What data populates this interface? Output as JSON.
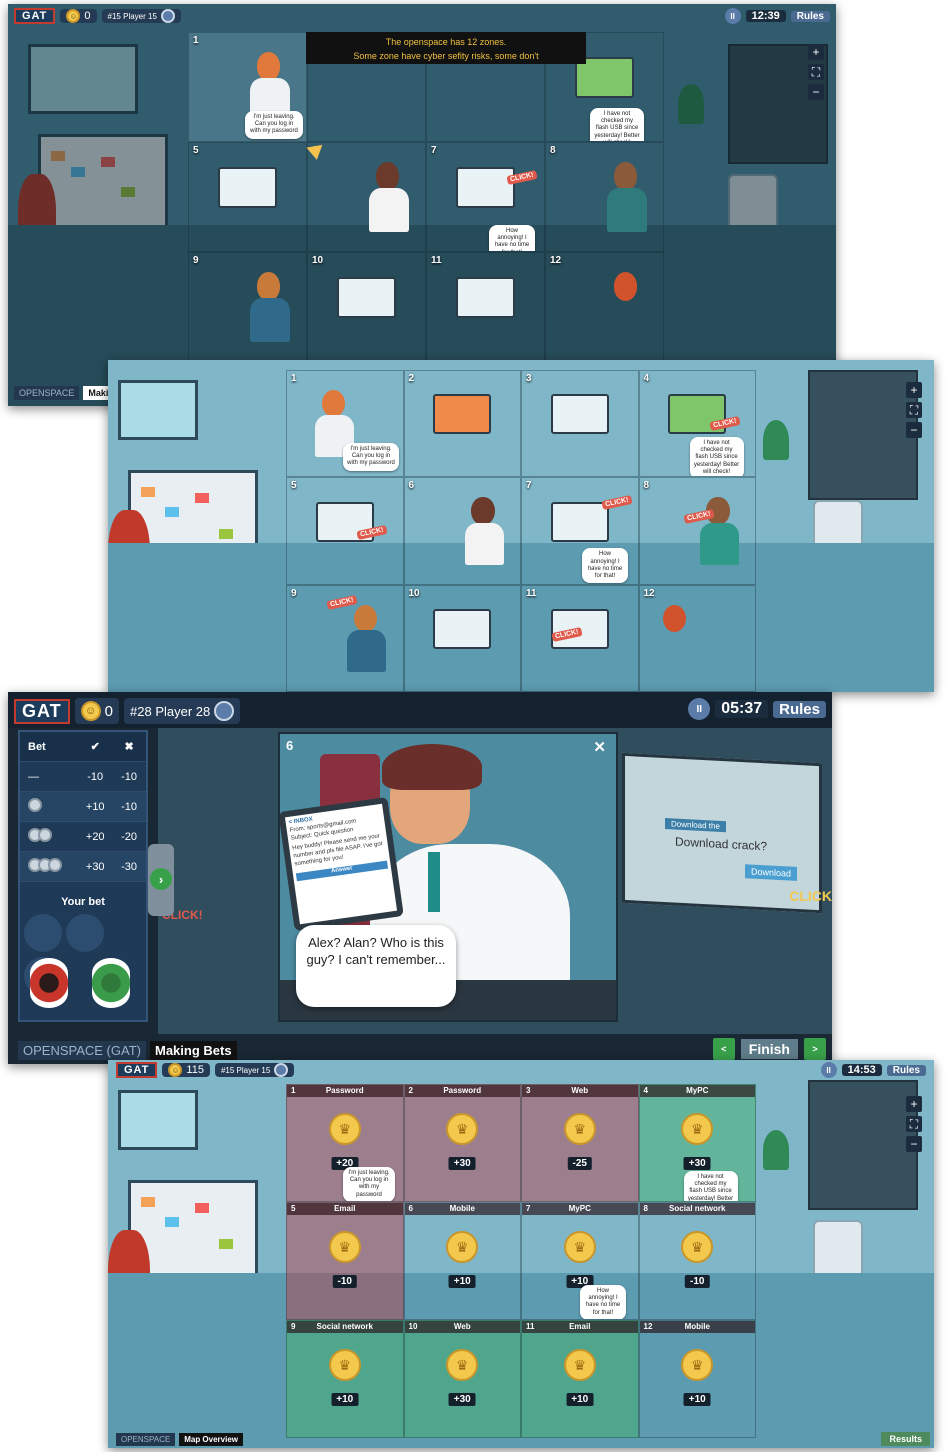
{
  "panel1": {
    "logo": "GAT",
    "coins": "0",
    "player": "#15 Player 15",
    "timer": "12:39",
    "rules": "Rules",
    "tooltip_line1": "The openspace has 12 zones.",
    "tooltip_line2": "Some zone have cyber sefity risks, some don't",
    "bubble1": "I'm just leaving. Can you log in with my password",
    "bubble4": "I have not checked my flash USB since yesterday! Better will check!",
    "bubble7": "How annoying! I have no time for that!",
    "click": "CLICK!",
    "bottom_left": "OPENSPACE",
    "bottom_tag": "Making"
  },
  "panel2": {
    "bubble1": "I'm just leaving. Can you log in with my password",
    "bubble4": "I have not checked my flash USB since yesterday! Better will check!",
    "bubble7": "How annoying! I have no time for that!",
    "click": "CLICK!"
  },
  "panel3": {
    "logo": "GAT",
    "coins": "0",
    "player": "#28 Player 28",
    "timer": "05:37",
    "rules": "Rules",
    "bet_header": "Bet",
    "bet_rows": [
      {
        "chips": 0,
        "label": "—",
        "win": "-10",
        "lose": "-10"
      },
      {
        "chips": 1,
        "label": "",
        "win": "+10",
        "lose": "-10"
      },
      {
        "chips": 2,
        "label": "",
        "win": "+20",
        "lose": "-20"
      },
      {
        "chips": 3,
        "label": "",
        "win": "+30",
        "lose": "-30"
      }
    ],
    "your_bet": "Your bet",
    "zone_number": "6",
    "close": "✕",
    "speech": "Alex? Alan? Who is this guy? I can't remember...",
    "email_header": "< INBOX",
    "email_from": "From: sports@gmail.com",
    "email_subject": "Subject: Quick question",
    "email_body": "Hey buddy! Please send me your number and pls file ASAP. I've got something for you!",
    "email_button": "Answer",
    "side_download_title": "Download the",
    "side_download": "Download crack?",
    "side_button": "Download",
    "side_click": "CLICK",
    "left_click": "CLICK!",
    "bottom_left": "OPENSPACE (GAT)",
    "bottom_tag": "Making Bets",
    "finish": "Finish",
    "prev": "<",
    "next": ">"
  },
  "panel4": {
    "logo": "GAT",
    "coins": "115",
    "player": "#15 Player 15",
    "timer": "14:53",
    "rules": "Rules",
    "bottom_left": "OPENSPACE",
    "bottom_tag": "Map Overview",
    "results": "Results",
    "zones": [
      {
        "n": "1",
        "title": "Password",
        "score": "+20",
        "tint": "red"
      },
      {
        "n": "2",
        "title": "Password",
        "score": "+30",
        "tint": "red"
      },
      {
        "n": "3",
        "title": "Web",
        "score": "-25",
        "tint": "red"
      },
      {
        "n": "4",
        "title": "MyPC",
        "score": "+30",
        "tint": "green"
      },
      {
        "n": "5",
        "title": "Email",
        "score": "-10",
        "tint": "red"
      },
      {
        "n": "6",
        "title": "Mobile",
        "score": "+10",
        "tint": "none"
      },
      {
        "n": "7",
        "title": "MyPC",
        "score": "+10",
        "tint": "none"
      },
      {
        "n": "8",
        "title": "Social network",
        "score": "-10",
        "tint": "none"
      },
      {
        "n": "9",
        "title": "Social network",
        "score": "+10",
        "tint": "green"
      },
      {
        "n": "10",
        "title": "Web",
        "score": "+30",
        "tint": "green"
      },
      {
        "n": "11",
        "title": "Email",
        "score": "+10",
        "tint": "green"
      },
      {
        "n": "12",
        "title": "Mobile",
        "score": "+10",
        "tint": "none"
      }
    ],
    "bubble1": "I'm just leaving. Can you log in with my password",
    "bubble4": "I have not checked my flash USB since yesterday! Better will check!",
    "bubble7": "How annoying! I have no time for that!"
  }
}
